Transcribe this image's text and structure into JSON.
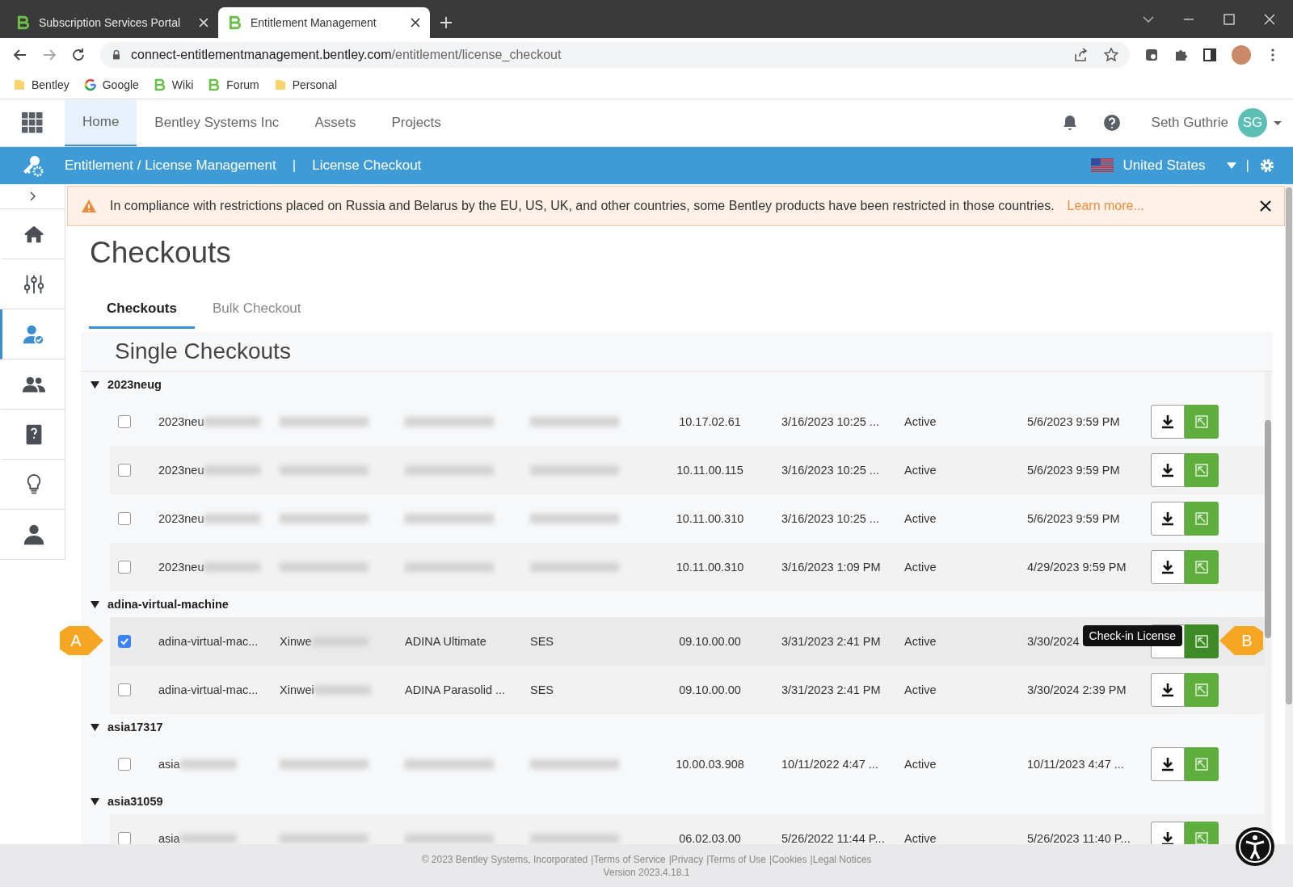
{
  "browser": {
    "tabs": [
      {
        "title": "Subscription Services Portal",
        "selected": false
      },
      {
        "title": "Entitlement Management",
        "selected": true
      }
    ],
    "url_host": "connect-entitlementmanagement.bentley.com",
    "url_path": "/entitlement/license_checkout",
    "bookmarks": [
      {
        "label": "Bentley",
        "kind": "folder"
      },
      {
        "label": "Google",
        "kind": "google"
      },
      {
        "label": "Wiki",
        "kind": "logo"
      },
      {
        "label": "Forum",
        "kind": "logo"
      },
      {
        "label": "Personal",
        "kind": "folder"
      }
    ]
  },
  "nav": {
    "items": [
      {
        "label": "Home",
        "selected": true
      },
      {
        "label": "Bentley Systems Inc",
        "selected": false
      },
      {
        "label": "Assets",
        "selected": false
      },
      {
        "label": "Projects",
        "selected": false
      }
    ],
    "user_name": "Seth Guthrie",
    "initials": "SG"
  },
  "context_bar": {
    "section": "Entitlement / License Management",
    "separator": "|",
    "page": "License Checkout",
    "region": "United States",
    "divider": "|"
  },
  "sidebar": [
    {
      "kind": "home",
      "selected": false
    },
    {
      "kind": "sliders",
      "selected": false
    },
    {
      "kind": "user-check",
      "selected": true
    },
    {
      "kind": "users",
      "selected": false
    },
    {
      "kind": "book",
      "selected": false
    },
    {
      "kind": "bulb",
      "selected": false
    },
    {
      "kind": "person",
      "selected": false
    }
  ],
  "banner": {
    "text": "In compliance with restrictions placed on Russia and Belarus by the EU, US, UK, and other countries, some Bentley products have been restricted in those countries.",
    "link": "Learn more..."
  },
  "page_title": "Checkouts",
  "page_tabs": [
    {
      "label": "Checkouts",
      "selected": true
    },
    {
      "label": "Bulk Checkout",
      "selected": false
    }
  ],
  "section_title": "Single Checkouts",
  "groups": [
    {
      "name": "2023neug",
      "expanded": true,
      "rows": [
        {
          "checked": false,
          "hovered": false,
          "machine": {
            "text": "2023neu",
            "blurred": true
          },
          "user": {
            "blurred": true
          },
          "product": {
            "blurred": true
          },
          "ss": {
            "blurred": true
          },
          "version": "10.17.02.61",
          "checkout": "3/16/2023 10:25 ...",
          "status": "Active",
          "expiry": "5/6/2023 9:59 PM"
        },
        {
          "checked": false,
          "hovered": false,
          "machine": {
            "text": "2023neu",
            "blurred": true
          },
          "user": {
            "blurred": true
          },
          "product": {
            "blurred": true
          },
          "ss": {
            "blurred": true
          },
          "version": "10.11.00.115",
          "checkout": "3/16/2023 10:25 ...",
          "status": "Active",
          "expiry": "5/6/2023 9:59 PM"
        },
        {
          "checked": false,
          "hovered": false,
          "machine": {
            "text": "2023neu",
            "blurred": true
          },
          "user": {
            "blurred": true
          },
          "product": {
            "blurred": true
          },
          "ss": {
            "blurred": true
          },
          "version": "10.11.00.310",
          "checkout": "3/16/2023 10:25 ...",
          "status": "Active",
          "expiry": "5/6/2023 9:59 PM"
        },
        {
          "checked": false,
          "hovered": false,
          "machine": {
            "text": "2023neu",
            "blurred": true
          },
          "user": {
            "blurred": true
          },
          "product": {
            "blurred": true
          },
          "ss": {
            "blurred": true
          },
          "version": "10.11.00.310",
          "checkout": "3/16/2023 1:09 PM",
          "status": "Active",
          "expiry": "4/29/2023 9:59 PM"
        }
      ]
    },
    {
      "name": "adina-virtual-machine",
      "expanded": true,
      "rows": [
        {
          "checked": true,
          "hovered": true,
          "machine": {
            "text": "adina-virtual-mac...",
            "blurred": false
          },
          "user": {
            "text": "Xinwe",
            "blurred": true
          },
          "product": {
            "text": "ADINA Ultimate",
            "blurred": false
          },
          "ss": {
            "text": "SES",
            "blurred": false
          },
          "version": "09.10.00.00",
          "checkout": "3/31/2023 2:41 PM",
          "status": "Active",
          "expiry": "3/30/2024",
          "tooltip": "Check-in License",
          "callout_left": "A",
          "callout_right": "B"
        },
        {
          "checked": false,
          "hovered": false,
          "machine": {
            "text": "adina-virtual-mac...",
            "blurred": false
          },
          "user": {
            "text": "Xinwei",
            "blurred": true
          },
          "product": {
            "text": "ADINA Parasolid ...",
            "blurred": false
          },
          "ss": {
            "text": "SES",
            "blurred": false
          },
          "version": "09.10.00.00",
          "checkout": "3/31/2023 2:41 PM",
          "status": "Active",
          "expiry": "3/30/2024 2:39 PM"
        }
      ]
    },
    {
      "name": "asia17317",
      "expanded": true,
      "rows": [
        {
          "checked": false,
          "hovered": false,
          "machine": {
            "text": "asia",
            "blurred": true
          },
          "user": {
            "blurred": true
          },
          "product": {
            "blurred": true
          },
          "ss": {
            "blurred": true
          },
          "version": "10.00.03.908",
          "checkout": "10/11/2022 4:47 ...",
          "status": "Active",
          "expiry": "10/11/2023 4:47 ..."
        }
      ]
    },
    {
      "name": "asia31059",
      "expanded": true,
      "rows": [
        {
          "checked": false,
          "hovered": false,
          "machine": {
            "text": "asia",
            "blurred": true
          },
          "user": {
            "blurred": true
          },
          "product": {
            "blurred": true
          },
          "ss": {
            "blurred": true
          },
          "version": "06.02.03.00",
          "checkout": "5/26/2022 11:44 P...",
          "status": "Active",
          "expiry": "5/26/2023 11:40 P..."
        }
      ]
    }
  ],
  "footer": {
    "copyright": "© 2023 Bentley Systems, Incorporated",
    "links": [
      "|Terms of Service",
      "|Privacy",
      "|Terms of Use",
      "|Cookies",
      "|Legal Notices"
    ],
    "version": "Version 2023.4.18.1"
  }
}
